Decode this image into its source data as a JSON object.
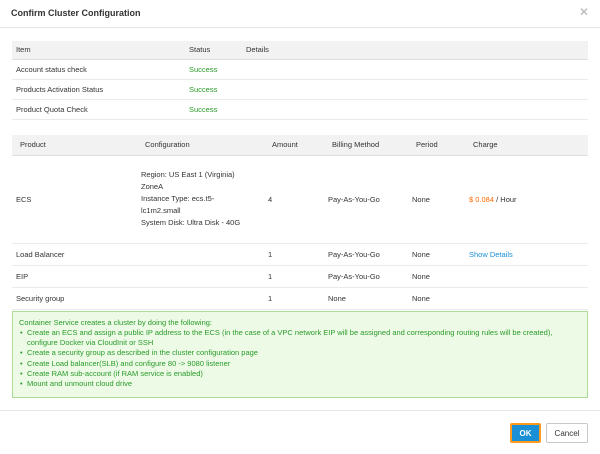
{
  "dialog": {
    "title": "Confirm Cluster Configuration",
    "close_glyph": "✕"
  },
  "checks": {
    "headers": [
      "Item",
      "Status",
      "Details"
    ],
    "rows": [
      {
        "item": "Account status check",
        "status": "Success",
        "details": ""
      },
      {
        "item": "Products Activation Status",
        "status": "Success",
        "details": ""
      },
      {
        "item": "Product Quota Check",
        "status": "Success",
        "details": ""
      }
    ]
  },
  "resources": {
    "headers": [
      "Product",
      "Configuration",
      "Amount",
      "Billing Method",
      "Period",
      "Charge"
    ],
    "ecs": {
      "product": "ECS",
      "config_lines": [
        "Region: US East 1 (Virginia)",
        "ZoneA",
        "Instance Type: ecs.t5-",
        "lc1m2.small",
        "System Disk: Ultra Disk - 40G"
      ],
      "amount": "4",
      "billing": "Pay-As-You-Go",
      "period": "None",
      "price": "$ 0.084",
      "price_unit": " / Hour"
    },
    "slb": {
      "product": "Load Balancer",
      "amount": "1",
      "billing": "Pay-As-You-Go",
      "period": "None",
      "charge_link": "Show Details"
    },
    "eip": {
      "product": "EIP",
      "amount": "1",
      "billing": "Pay-As-You-Go",
      "period": "None"
    },
    "sg": {
      "product": "Security group",
      "amount": "1",
      "billing": "None",
      "period": "None"
    }
  },
  "info": {
    "intro": "Container Service creates a cluster by doing the following:",
    "items": [
      "Create an ECS and assign a public IP address to the ECS (in the case of a VPC network EIP will be assigned and corresponding routing rules will be created), configure Docker via CloudInit or SSH",
      "Create a security group as described in the cluster configuration page",
      "Create Load balancer(SLB) and configure 80 -> 9080 listener",
      "Create RAM sub-account (if RAM service is enabled)",
      "Mount and unmount cloud drive"
    ]
  },
  "footer": {
    "ok_label": "OK",
    "cancel_label": "Cancel"
  },
  "colors": {
    "success": "#2a9a2a",
    "price": "#ff6a00",
    "link": "#1b8fd6",
    "primary": "#1b8fd6",
    "focus_ring": "#ff9a1e",
    "info_bg": "#edfbe6",
    "info_border": "#aedc98"
  }
}
